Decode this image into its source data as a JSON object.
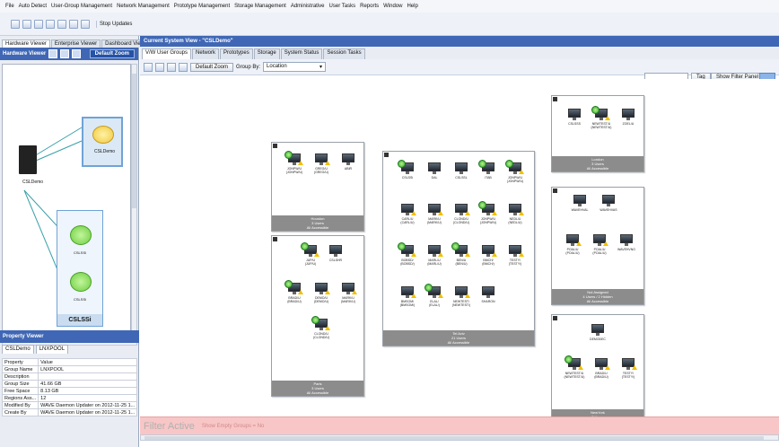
{
  "menu": [
    "File",
    "Auto Detect",
    "User-Group Management",
    "Network Management",
    "Prototype Management",
    "Storage Management",
    "Administrative",
    "User Tasks",
    "Reports",
    "Window",
    "Help"
  ],
  "toolbar": {
    "stop_label": "Stop Updates"
  },
  "left": {
    "tabs": [
      "Hardware Viewer",
      "Enterprise Viewer",
      "Dashboard View"
    ],
    "hw_title": "Hardware Viewer",
    "default_zoom": "Default Zoom",
    "server_label": "CSLDemo",
    "hw_top_cloud_label": "CSLDemo",
    "hw_cloud1_label": "CSLSSi",
    "hw_cloud2_label": "CSLSSi",
    "hw_group_label": "CSLSSi"
  },
  "property": {
    "title": "Property Viewer",
    "tabs": [
      "CSLDemo",
      "LNXPOOL"
    ],
    "headers": [
      "Property",
      "Value"
    ],
    "rows": [
      [
        "Group Name",
        "LNXPOOL"
      ],
      [
        "Description",
        ""
      ],
      [
        "Group Size",
        "41.66 GB"
      ],
      [
        "Free Space",
        "8.13 GB"
      ],
      [
        "Regions Ass...",
        "12"
      ],
      [
        "Modified By",
        "WAVE Daemon Updater on 2012-11-25 1..."
      ],
      [
        "Create By",
        "WAVE Daemon Updater on 2012-11-25 1..."
      ]
    ]
  },
  "main": {
    "title": "Current System View - \"CSLDemo\"",
    "tabs": [
      "V/W User Groups",
      "Network",
      "Prototypes",
      "Storage",
      "System Status",
      "Session Tasks"
    ],
    "default_zoom": "Default Zoom",
    "group_by_label": "Group By:",
    "group_by_value": "Location",
    "tag_btn": "Tag",
    "filter_btn": "Show Filter Panel",
    "filter_active": "Filter Active",
    "filter_desc": "Show Empty Groups = No"
  },
  "groups": [
    {
      "foot": [
        "Houston",
        "3 Users",
        "All Accessible"
      ],
      "devices": [
        [
          "JONPW/U",
          "(JONPW/U)"
        ],
        [
          "GREG/U",
          "(GREG/U)"
        ],
        [
          "ABIR",
          ""
        ]
      ]
    },
    {
      "foot": [
        "Paris",
        "3 Users",
        "All Accessible"
      ],
      "devices": [
        [
          "JUP/U",
          "(JUP/U)"
        ],
        [
          "CSLSHR",
          ""
        ],
        [
          "BRAD/U",
          "(BRAD/U)"
        ],
        [
          "DEMO/U",
          "(DEMO/U)"
        ],
        [
          "MARK/U",
          "(MARK/U)"
        ],
        [
          "CLOND/U",
          "(CLOND/U)"
        ]
      ]
    },
    {
      "foot": [
        "Tel Aviv",
        "21 Users",
        "All Accessible"
      ],
      "devices": [
        [
          "CSLSSi",
          ""
        ],
        [
          "DAL",
          ""
        ],
        [
          "CSLSSL",
          ""
        ],
        [
          "ITAB",
          ""
        ],
        [
          "JONPW/U",
          "(JONPW/U)"
        ],
        [
          "CARL/U",
          "(CARL/U)"
        ],
        [
          "MARK/U",
          "(MARK/U)"
        ],
        [
          "CLOND/U",
          "(CLOND/U)"
        ],
        [
          "JONPW/U",
          "(JONPW/U)"
        ],
        [
          "NEDL/U",
          "(NEDL/U)"
        ],
        [
          "BOBSD/",
          "(BOBSD/)"
        ],
        [
          "MARL/U",
          "(MARL/U)"
        ],
        [
          "BEN/U",
          "(BEN/U)"
        ],
        [
          "BMCH/",
          "(BMCH/)"
        ],
        [
          "TESTY/",
          "(TESTY/)"
        ],
        [
          "BMSOM/",
          "(BMSOM/)"
        ],
        [
          "ELAL/",
          "(ELAL/)"
        ],
        [
          "NEWTEST/",
          "(NEWTEST/)"
        ],
        [
          "SHARON",
          ""
        ]
      ]
    },
    {
      "foot": [
        "London",
        "3 Users",
        "All Accessible"
      ],
      "devices": [
        [
          "CSLSSS",
          ""
        ],
        [
          "NEWTEST/U",
          "(NEWTEST/U)"
        ],
        [
          "ZOEL/U",
          ""
        ]
      ]
    },
    {
      "foot": [
        "Not Assigned",
        "4 Users / 2 Hidden",
        "All Accessible"
      ],
      "devices": [
        [
          "WAVEHVAL",
          ""
        ],
        [
          "WAVEHVAS",
          ""
        ],
        [
          "POAL/U",
          "(POAL/U)"
        ],
        [
          "POAL/U",
          "(POAL/U)"
        ],
        [
          "WAVEHVNG",
          ""
        ]
      ]
    },
    {
      "foot": [
        "NewYork",
        "3 Users",
        "All Accessible"
      ],
      "devices": [
        [
          "DEMODEC",
          ""
        ],
        [
          "NEWTEST/U",
          "(NEWTEST/U)"
        ],
        [
          "BRAD/U",
          "(BRAD/U)"
        ],
        [
          "TESTY/",
          "(TESTY/)"
        ]
      ]
    }
  ]
}
